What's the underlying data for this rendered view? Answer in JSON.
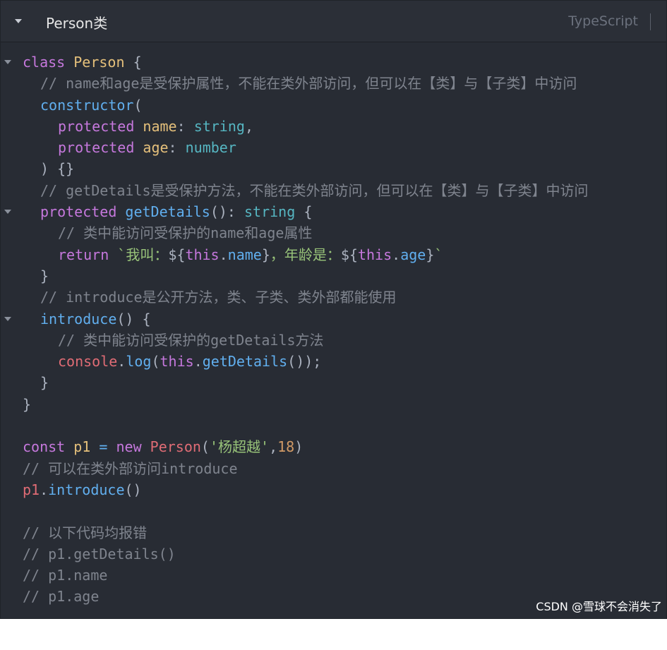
{
  "header": {
    "title": "Person类",
    "language": "TypeScript"
  },
  "code": {
    "l1": {
      "kw": "class",
      "name": "Person",
      "brace": "{"
    },
    "l2": "// name和age是受保护属性，不能在类外部访问，但可以在【类】与【子类】中访问",
    "l3": {
      "fn": "constructor",
      "open": "("
    },
    "l4": {
      "kw": "protected",
      "prop": "name",
      "colon": ":",
      "type": "string",
      "comma": ","
    },
    "l5": {
      "kw": "protected",
      "prop": "age",
      "colon": ":",
      "type": "number"
    },
    "l6": ") {}",
    "l7": "// getDetails是受保护方法，不能在类外部访问，但可以在【类】与【子类】中访问",
    "l8": {
      "kw": "protected",
      "fn": "getDetails",
      "paren": "():",
      "type": "string",
      "brace": "{"
    },
    "l9": "// 类中能访问受保护的name和age属性",
    "l10": {
      "kw": "return",
      "s1": "`我叫：",
      "i1o": "${",
      "this1": "this",
      "dot1": ".",
      "p1": "name",
      "i1c": "}",
      "s2": "，年龄是：",
      "i2o": "${",
      "this2": "this",
      "dot2": ".",
      "p2": "age",
      "i2c": "}",
      "s3": "`"
    },
    "l11": "}",
    "l12": "// introduce是公开方法，类、子类、类外部都能使用",
    "l13": {
      "fn": "introduce",
      "rest": "() {"
    },
    "l14": "// 类中能访问受保护的getDetails方法",
    "l15": {
      "obj": "console",
      "dot1": ".",
      "m1": "log",
      "open": "(",
      "this": "this",
      "dot2": ".",
      "m2": "getDetails",
      "close": "());"
    },
    "l16": "}",
    "l17": "}",
    "l19": {
      "kw1": "const",
      "var": "p1",
      "eq": "=",
      "kw2": "new",
      "cls": "Person",
      "open": "(",
      "str": "'杨超越'",
      "comma": ",",
      "num": "18",
      "close": ")"
    },
    "l20": "// 可以在类外部访问introduce",
    "l21": {
      "var": "p1",
      "dot": ".",
      "fn": "introduce",
      "paren": "()"
    },
    "l23": "// 以下代码均报错",
    "l24": "// p1.getDetails()",
    "l25": "// p1.name",
    "l26": "// p1.age"
  },
  "watermark": "CSDN @雪球不会消失了",
  "colors": {
    "background": "#282c34",
    "keyword": "#c678dd",
    "class": "#e5c07b",
    "function": "#61afef",
    "type": "#56b6c2",
    "comment": "#7f848e",
    "string": "#98c379",
    "number": "#d19a66",
    "variable": "#e06c75"
  },
  "icons": [
    "collapse-caret-icon",
    "fold-arrow-icon"
  ]
}
